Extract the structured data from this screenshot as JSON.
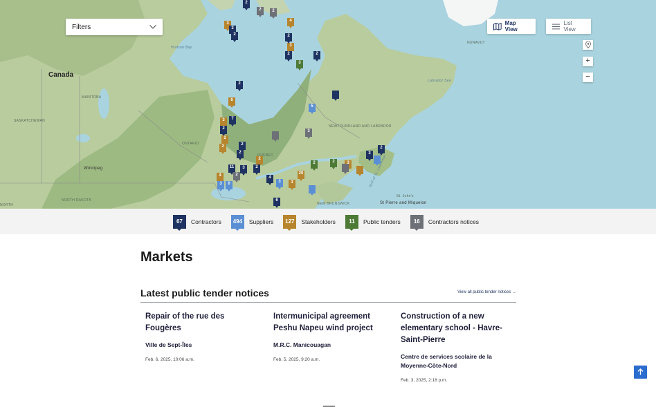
{
  "filters": {
    "label": "Filters"
  },
  "view_toggle": {
    "map_label": "Map View",
    "list_label": "List View"
  },
  "map_controls": {
    "zoom_in": "+",
    "zoom_out": "−"
  },
  "map": {
    "labels": {
      "canada": "Canada",
      "hudson_bay": "Hudson Bay",
      "manitoba": "MANITOBA",
      "saskatchewan": "SASKATCHEWAN",
      "ontario": "ONTARIO",
      "quebec": "QUEBEC",
      "newfoundland": "NEWFOUNDLAND AND LABRADOR",
      "labrador_sea": "Labrador Sea",
      "nunavut": "NUNAVUT",
      "winnipeg": "Winnipeg",
      "north_dakota": "NORTH DAKOTA",
      "st_pierre": "St Pierre and Miquelon",
      "st_johns": "St. John's",
      "gulf": "Gulf of St. Lawrence",
      "new_brunswick": "NEW BRUNSWICK",
      "north_side": "NORTH"
    },
    "pins": [
      {
        "t": "c",
        "n": "2"
      },
      {
        "t": "n",
        "n": "2"
      },
      {
        "t": "n",
        "n": "2"
      },
      {
        "t": "k",
        "n": "4"
      },
      {
        "t": "k",
        "n": "3"
      },
      {
        "t": "c",
        "n": "3"
      },
      {
        "t": "c",
        "n": "2"
      },
      {
        "t": "k",
        "n": "3"
      },
      {
        "t": "c",
        "n": "2"
      },
      {
        "t": "t",
        "n": "3"
      },
      {
        "t": "c",
        "n": "2"
      },
      {
        "t": "c",
        "n": "2"
      },
      {
        "t": "c",
        "n": "2"
      },
      {
        "t": "k",
        "n": "6"
      },
      {
        "t": "s",
        "n": "5"
      },
      {
        "t": "c",
        "n": ""
      },
      {
        "t": "k",
        "n": "3"
      },
      {
        "t": "c",
        "n": "7"
      },
      {
        "t": "c",
        "n": "2"
      },
      {
        "t": "k",
        "n": "2"
      },
      {
        "t": "k",
        "n": "2"
      },
      {
        "t": "c",
        "n": "2"
      },
      {
        "t": "c",
        "n": "2"
      },
      {
        "t": "n",
        "n": ""
      },
      {
        "t": "n",
        "n": "3"
      },
      {
        "t": "c",
        "n": "11"
      },
      {
        "t": "c",
        "n": "3"
      },
      {
        "t": "k",
        "n": "2"
      },
      {
        "t": "c",
        "n": "2"
      },
      {
        "t": "k",
        "n": "4"
      },
      {
        "t": "n",
        "n": "2"
      },
      {
        "t": "s",
        "n": "3"
      },
      {
        "t": "s",
        "n": "0"
      },
      {
        "t": "c",
        "n": "4"
      },
      {
        "t": "s",
        "n": "3"
      },
      {
        "t": "k",
        "n": "3"
      },
      {
        "t": "k",
        "n": "20"
      },
      {
        "t": "t",
        "n": "2"
      },
      {
        "t": "t",
        "n": "2"
      },
      {
        "t": "k",
        "n": "3"
      },
      {
        "t": "c",
        "n": "3"
      },
      {
        "t": "c",
        "n": "2"
      },
      {
        "t": "c",
        "n": "6"
      },
      {
        "t": "s",
        "n": ""
      },
      {
        "t": "n",
        "n": ""
      },
      {
        "t": "k",
        "n": ""
      },
      {
        "t": "s",
        "n": ""
      }
    ]
  },
  "legend": [
    {
      "count": "67",
      "label": "Contractors",
      "color": "#1e3361"
    },
    {
      "count": "494",
      "label": "Suppliers",
      "color": "#5b8fd4"
    },
    {
      "count": "127",
      "label": "Stakeholders",
      "color": "#b7852d"
    },
    {
      "count": "11",
      "label": "Public tenders",
      "color": "#4d7a35"
    },
    {
      "count": "16",
      "label": "Contractors notices",
      "color": "#6d7077"
    }
  ],
  "markets": {
    "heading": "Markets"
  },
  "notices": {
    "heading": "Latest public tender notices",
    "view_all": "View all public tender notices →",
    "cards": [
      {
        "title": "Repair of the rue des Fougères",
        "org": "Ville de Sept-Îles",
        "date": "Feb. 6, 2025, 10:06 a.m."
      },
      {
        "title": "Intermunicipal agreement Peshu Napeu wind project",
        "org": "M.R.C. Manicouagan",
        "date": "Feb. 5, 2025, 9:20 a.m."
      },
      {
        "title": "Construction of a new elementary school - Havre-Saint-Pierre",
        "org": "Centre de services scolaire de la Moyenne-Côte-Nord",
        "date": "Feb. 3, 2025, 2:18 p.m."
      }
    ]
  }
}
